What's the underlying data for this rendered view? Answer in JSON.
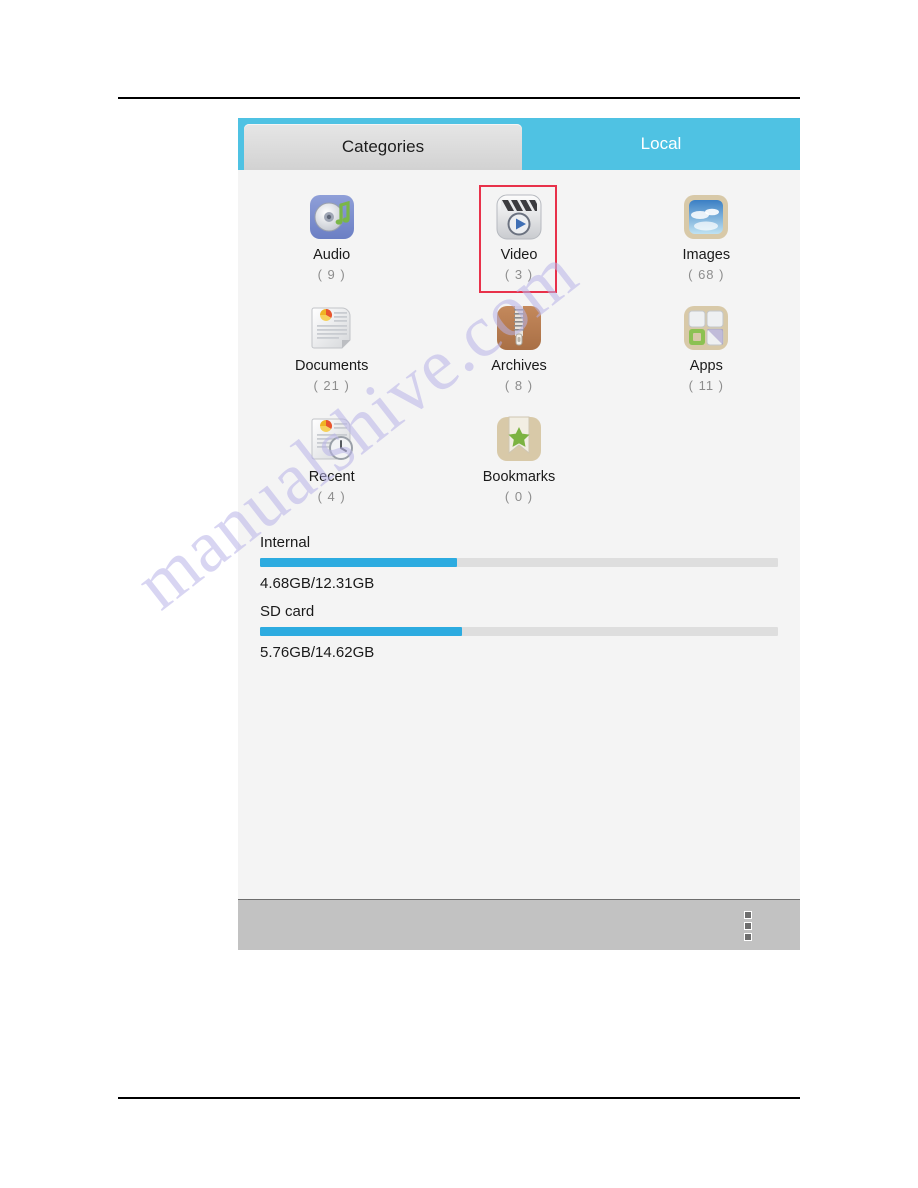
{
  "app": {
    "tabs": [
      {
        "label": "Categories",
        "state": "active"
      },
      {
        "label": "Local",
        "state": "inactive"
      }
    ],
    "accent_color": "#4fc2e3",
    "selection_color": "#e8314a",
    "progress_color": "#2cabe0",
    "categories": [
      {
        "label": "Audio",
        "count": "( 9 )",
        "icon": "audio-cd-icon",
        "selected": false
      },
      {
        "label": "Video",
        "count": "( 3 )",
        "icon": "video-clapper-icon",
        "selected": true
      },
      {
        "label": "Images",
        "count": "( 68 )",
        "icon": "images-photo-icon",
        "selected": false
      },
      {
        "label": "Documents",
        "count": "( 21 )",
        "icon": "document-icon",
        "selected": false
      },
      {
        "label": "Archives",
        "count": "( 8 )",
        "icon": "archive-zip-icon",
        "selected": false
      },
      {
        "label": "Apps",
        "count": "( 11 )",
        "icon": "apps-grid-icon",
        "selected": false
      },
      {
        "label": "Recent",
        "count": "( 4 )",
        "icon": "recent-clock-icon",
        "selected": false
      },
      {
        "label": "Bookmarks",
        "count": "( 0 )",
        "icon": "bookmark-star-icon",
        "selected": false
      }
    ],
    "storage": [
      {
        "name": "Internal",
        "value": "4.68GB/12.31GB",
        "percent": 38
      },
      {
        "name": "SD card",
        "value": "5.76GB/14.62GB",
        "percent": 39
      }
    ],
    "toolbar": {
      "overflow_label": "overflow-menu"
    }
  },
  "page": {
    "watermark": "manualshive.com"
  }
}
